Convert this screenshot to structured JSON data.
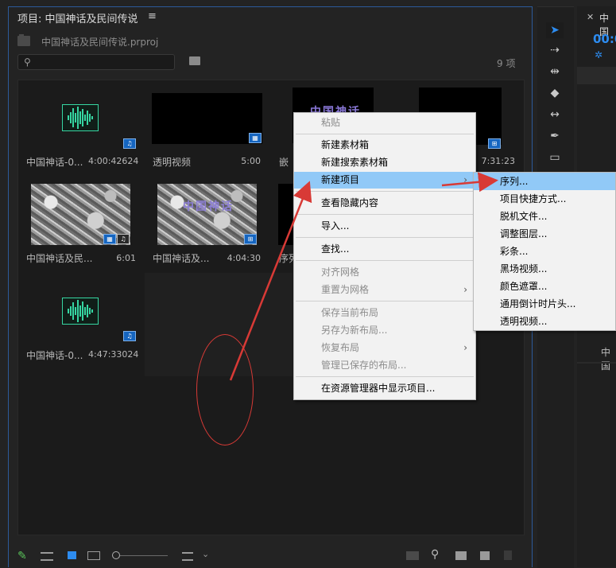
{
  "project_panel": {
    "title": "项目: 中国神话及民间传说",
    "menu_icon": "≡",
    "file_name": "中国神话及民间传说.prproj",
    "search_placeholder": "",
    "item_count": "9 项"
  },
  "items": [
    {
      "name": "中国神话-0...",
      "duration": "4:00:42624",
      "thumb": "audio"
    },
    {
      "name": "透明视频",
      "duration": "5:00",
      "thumb": "black"
    },
    {
      "name": "嵌",
      "duration": "",
      "thumb": "title",
      "thumb_text": "中国神话"
    },
    {
      "name": "",
      "duration": "7:31:23",
      "thumb": "black"
    },
    {
      "name": "中国神话及民...",
      "duration": "6:01",
      "thumb": "ink"
    },
    {
      "name": "中国神话及...",
      "duration": "4:04:30",
      "thumb": "ink-title",
      "thumb_text": "中国神话"
    },
    {
      "name": "序列",
      "duration": "",
      "thumb": "black"
    },
    {
      "name": "中国神话-0...",
      "duration": "4:47:33024",
      "thumb": "audio"
    }
  ],
  "context_menu": {
    "items": [
      {
        "label": "粘贴",
        "enabled": false
      },
      {
        "label": "新建素材箱",
        "enabled": true
      },
      {
        "label": "新建搜索素材箱",
        "enabled": true
      },
      {
        "label": "新建项目",
        "enabled": true,
        "submenu": true,
        "active": true
      },
      {
        "label": "查看隐藏内容",
        "enabled": true
      },
      {
        "label": "导入...",
        "enabled": true
      },
      {
        "label": "查找...",
        "enabled": true
      },
      {
        "label": "对齐网格",
        "enabled": false
      },
      {
        "label": "重置为网格",
        "enabled": false,
        "submenu": true
      },
      {
        "label": "保存当前布局",
        "enabled": false
      },
      {
        "label": "另存为新布局...",
        "enabled": false
      },
      {
        "label": "恢复布局",
        "enabled": false,
        "submenu": true
      },
      {
        "label": "管理已保存的布局...",
        "enabled": false
      },
      {
        "label": "在资源管理器中显示项目...",
        "enabled": true
      }
    ],
    "submenu_arrow": "›"
  },
  "submenu": {
    "items": [
      {
        "label": "序列...",
        "active": true
      },
      {
        "label": "项目快捷方式..."
      },
      {
        "label": "脱机文件..."
      },
      {
        "label": "调整图层..."
      },
      {
        "label": "彩条..."
      },
      {
        "label": "黑场视频..."
      },
      {
        "label": "颜色遮罩..."
      },
      {
        "label": "通用倒计时片头..."
      },
      {
        "label": "透明视频..."
      }
    ]
  },
  "right_panel": {
    "tab_close": "✕",
    "tab_label": "中国",
    "timecode": "00:0",
    "bottom_label": "中国"
  },
  "badges": {
    "audio": "♫",
    "video": "▦",
    "sequence": "⊞"
  },
  "colors": {
    "accent": "#2d8cf0",
    "menu_highlight": "#91c9f7",
    "annotation_red": "#d83a36",
    "waveform": "#36d6a2"
  }
}
